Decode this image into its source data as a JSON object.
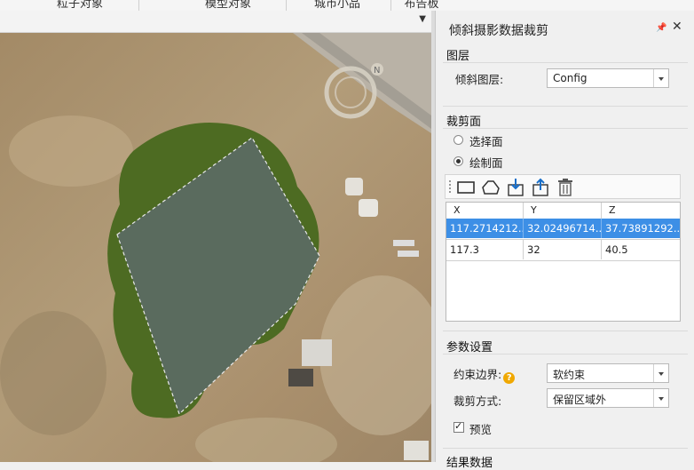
{
  "top_tabs": [
    "粒子对象",
    "模型对象",
    "城市小品",
    "布告板"
  ],
  "panel": {
    "title": "倾斜摄影数据裁剪",
    "layer_section": {
      "title": "图层",
      "label": "倾斜图层:",
      "value": "Config"
    },
    "clip_section": {
      "title": "裁剪面",
      "options": [
        {
          "label": "选择面",
          "checked": false
        },
        {
          "label": "绘制面",
          "checked": true
        }
      ],
      "tools": [
        "rectangle-icon",
        "polygon-icon",
        "import-icon",
        "export-icon",
        "delete-icon"
      ],
      "table": {
        "columns": [
          "X",
          "Y",
          "Z"
        ],
        "rows": [
          [
            "117.2714212...",
            "32.02496714...",
            "37.73891292..."
          ],
          [
            "117.3",
            "32",
            "40.5"
          ]
        ],
        "selected_row": 0
      }
    },
    "params_section": {
      "title": "参数设置",
      "boundary_label": "约束边界:",
      "boundary_value": "软约束",
      "mode_label": "裁剪方式:",
      "mode_value": "保留区域外",
      "preview_label": "预览",
      "preview_checked": true
    },
    "result_section": {
      "title": "结果数据"
    }
  },
  "compass": {
    "label": "N"
  },
  "colors": {
    "selection": "#3d8fe6",
    "clip_fill": "#5a6b5e",
    "clip_border": "#4d6b22",
    "help": "#f0a800"
  }
}
